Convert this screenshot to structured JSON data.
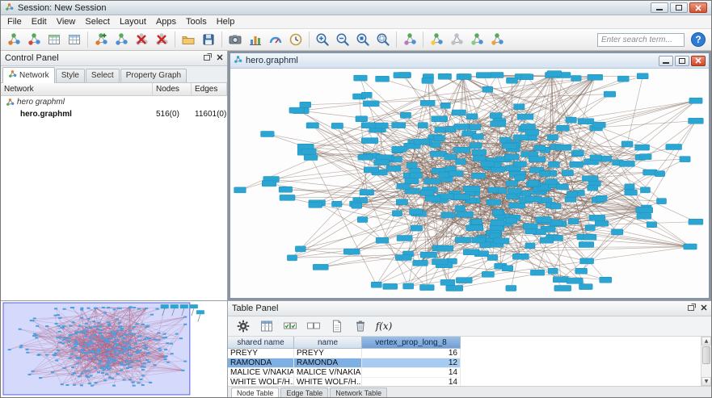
{
  "window": {
    "title": "Session: New Session"
  },
  "menu_bar": {
    "items": [
      "File",
      "Edit",
      "View",
      "Select",
      "Layout",
      "Apps",
      "Tools",
      "Help"
    ]
  },
  "toolbar": {
    "search_placeholder": "Enter search term...",
    "help_label": "?",
    "buttons": [
      {
        "name": "import-network-from-file-button",
        "icon": "net",
        "a": "#e07b2a"
      },
      {
        "name": "import-network-from-url-button",
        "icon": "net",
        "a": "#cc4a3d"
      },
      {
        "name": "import-table-from-file-button",
        "icon": "table",
        "a": "#8fce8f"
      },
      {
        "name": "import-table-from-url-button",
        "icon": "table",
        "a": "#9fc2ec"
      },
      {
        "sep": true
      },
      {
        "name": "new-empty-network-button",
        "icon": "net-plus"
      },
      {
        "name": "clone-network-button",
        "icon": "net",
        "a": "#4a90d9"
      },
      {
        "name": "destroy-network-button",
        "icon": "net-x"
      },
      {
        "name": "destroy-view-button",
        "icon": "net-x"
      },
      {
        "sep": true
      },
      {
        "name": "open-session-button",
        "icon": "folder"
      },
      {
        "name": "save-session-button",
        "icon": "floppy"
      },
      {
        "sep": true
      },
      {
        "name": "network-snapshot-button",
        "icon": "camera"
      },
      {
        "name": "chart-button",
        "icon": "bars"
      },
      {
        "name": "gauge-button",
        "icon": "gauge"
      },
      {
        "name": "timer-button",
        "icon": "clock"
      },
      {
        "sep": true
      },
      {
        "name": "zoom-in-button",
        "icon": "zoom-in"
      },
      {
        "name": "zoom-out-button",
        "icon": "zoom-out"
      },
      {
        "name": "zoom-selected-button",
        "icon": "zoom-sel"
      },
      {
        "name": "zoom-fit-content-button",
        "icon": "zoom-fit"
      },
      {
        "sep": true
      },
      {
        "name": "apply-style-button",
        "icon": "net",
        "a": "#b07cc6"
      },
      {
        "sep": true
      },
      {
        "name": "first-neighbors-button",
        "icon": "net",
        "a": "#f2cf3a"
      },
      {
        "name": "hide-selected-button",
        "icon": "net",
        "a": "#b9c2cc",
        "b": "#b9c2cc",
        "c": "#b9c2cc"
      },
      {
        "name": "show-all-button",
        "icon": "net",
        "a": "#7fd07f"
      },
      {
        "name": "annotation-mode-button",
        "icon": "net",
        "a": "#f0a040"
      }
    ]
  },
  "control_panel": {
    "title": "Control Panel",
    "tabs": [
      {
        "label": "Network",
        "active": true,
        "icon": true
      },
      {
        "label": "Style",
        "active": false
      },
      {
        "label": "Select",
        "active": false
      },
      {
        "label": "Property Graph",
        "active": false
      }
    ],
    "columns": [
      "Network",
      "Nodes",
      "Edges"
    ],
    "tree": [
      {
        "type": "collection",
        "label": "hero graphml",
        "nodes": "",
        "edges": ""
      },
      {
        "type": "network",
        "label": "hero.graphml",
        "nodes": "516(0)",
        "edges": "11601(0)"
      }
    ]
  },
  "network_window": {
    "title": "hero.graphml"
  },
  "table_panel": {
    "title": "Table Panel",
    "toolbar": [
      {
        "name": "table-options-button",
        "icon": "gear"
      },
      {
        "name": "show-columns-button",
        "icon": "cols"
      },
      {
        "name": "select-all-rows-button",
        "icon": "checks"
      },
      {
        "name": "deselect-all-rows-button",
        "icon": "boxes"
      },
      {
        "name": "create-column-button",
        "icon": "page"
      },
      {
        "name": "delete-columns-button",
        "icon": "trash"
      },
      {
        "name": "function-builder-button",
        "icon": "fx",
        "label": "f(x)"
      }
    ],
    "columns": [
      {
        "label": "shared name",
        "selected": false
      },
      {
        "label": "name",
        "selected": false
      },
      {
        "label": "vertex_prop_long_8",
        "selected": true
      }
    ],
    "rows": [
      {
        "shared_name": "PREYY",
        "name": "PREYY",
        "value": "16",
        "selected": false
      },
      {
        "shared_name": "RAMONDA",
        "name": "RAMONDA",
        "value": "12",
        "selected": true
      },
      {
        "shared_name": "MALICE V/NAKIA",
        "name": "MALICE V/NAKIA",
        "value": "14",
        "selected": false
      },
      {
        "shared_name": "WHITE WOLF/H..",
        "name": "WHITE WOLF/H..",
        "value": "14",
        "selected": false
      }
    ],
    "tabs": [
      {
        "label": "Node Table",
        "active": true
      },
      {
        "label": "Edge Table",
        "active": false
      },
      {
        "label": "Network Table",
        "active": false
      }
    ]
  },
  "graph": {
    "seed": 13,
    "node_color": "#2ba6d3",
    "node_stroke": "#1f8fba",
    "edge_color": "rgba(125,100,85,0.5)",
    "core_nodes": 250,
    "scatter_nodes": 50,
    "top_row_nodes": 14,
    "hub_count": 9,
    "birdseye": {
      "edge_color": "rgba(190,70,70,0.4)",
      "overlay_fill": "rgba(135,145,245,0.35)",
      "overlay_stroke": "#5a64d8"
    }
  }
}
